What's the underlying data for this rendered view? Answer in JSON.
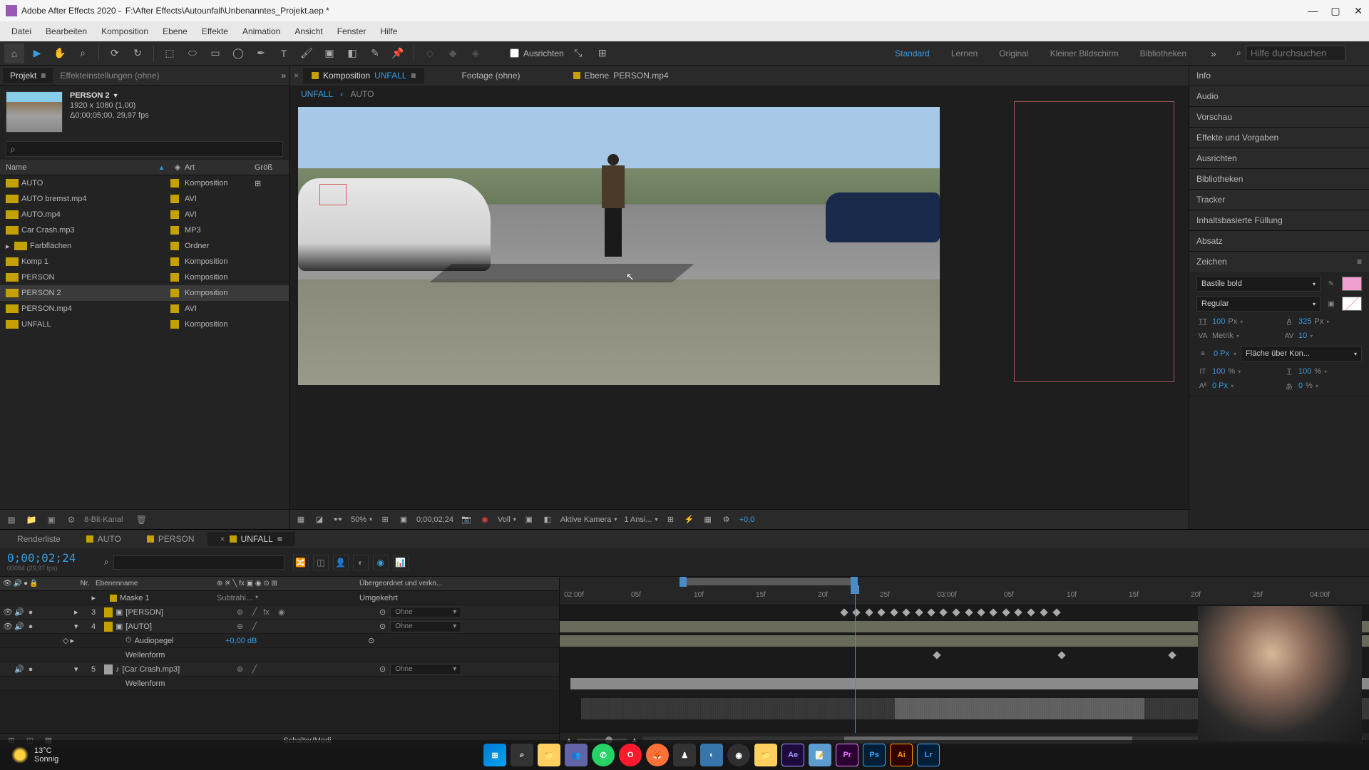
{
  "title": {
    "app_prefix": "Adobe After Effects 2020 -",
    "file_path": "F:\\After Effects\\Autounfall\\Unbenanntes_Projekt.aep *"
  },
  "menu": [
    "Datei",
    "Bearbeiten",
    "Komposition",
    "Ebene",
    "Effekte",
    "Animation",
    "Ansicht",
    "Fenster",
    "Hilfe"
  ],
  "toolbar": {
    "align_label": "Ausrichten"
  },
  "workspaces": [
    "Standard",
    "Lernen",
    "Original",
    "Kleiner Bildschirm",
    "Bibliotheken"
  ],
  "help_search_placeholder": "Hilfe durchsuchen",
  "left_tabs": {
    "project": "Projekt",
    "effects": "Effekteinstellungen (ohne)"
  },
  "project_thumb": {
    "name": "PERSON 2",
    "dims": "1920 x 1080 (1,00)",
    "duration": "Δ0;00;05;00, 29,97 fps"
  },
  "project_cols": {
    "name": "Name",
    "art": "Art",
    "size": "Größ"
  },
  "project_items": [
    {
      "name": "AUTO",
      "type": "Komposition",
      "color": "#c4a000",
      "icon": "comp"
    },
    {
      "name": "AUTO bremst.mp4",
      "type": "AVI",
      "color": "#c4a000",
      "icon": "avi"
    },
    {
      "name": "AUTO.mp4",
      "type": "AVI",
      "color": "#c4a000",
      "icon": "avi"
    },
    {
      "name": "Car Crash.mp3",
      "type": "MP3",
      "color": "#c4a000",
      "icon": "mp3"
    },
    {
      "name": "Farbflächen",
      "type": "Ordner",
      "color": "#c4a000",
      "icon": "folder"
    },
    {
      "name": "Komp 1",
      "type": "Komposition",
      "color": "#c4a000",
      "icon": "comp"
    },
    {
      "name": "PERSON",
      "type": "Komposition",
      "color": "#c4a000",
      "icon": "comp"
    },
    {
      "name": "PERSON 2",
      "type": "Komposition",
      "color": "#c4a000",
      "icon": "comp",
      "selected": true
    },
    {
      "name": "PERSON.mp4",
      "type": "AVI",
      "color": "#c4a000",
      "icon": "mp4"
    },
    {
      "name": "UNFALL",
      "type": "Komposition",
      "color": "#c4a000",
      "icon": "comp"
    }
  ],
  "depth_label": "8-Bit-Kanal",
  "viewer_tabs": {
    "comp_prefix": "Komposition",
    "comp_name": "UNFALL",
    "footage": "Footage (ohne)",
    "layer_prefix": "Ebene",
    "layer_name": "PERSON.mp4"
  },
  "breadcrumb": [
    "UNFALL",
    "AUTO"
  ],
  "viewer_footer": {
    "zoom": "50%",
    "time": "0;00;02;24",
    "res": "Voll",
    "camera": "Aktive Kamera",
    "view_count": "1 Ansi...",
    "exposure": "+0,0"
  },
  "right_panels": [
    "Info",
    "Audio",
    "Vorschau",
    "Effekte und Vorgaben",
    "Ausrichten",
    "Bibliotheken",
    "Tracker",
    "Inhaltsbasierte Füllung",
    "Absatz",
    "Zeichen"
  ],
  "char": {
    "font": "Bastile bold",
    "style": "Regular",
    "size": "100",
    "size_unit": "Px",
    "leading": "325",
    "leading_unit": "Px",
    "kerning": "Metrik",
    "tracking": "10",
    "stroke_w": "0 Px",
    "stroke_mode": "Fläche über Kon...",
    "vscale": "100",
    "hscale": "100",
    "baseline": "0 Px",
    "tsume": "0"
  },
  "timeline_tabs": [
    "Renderliste",
    "AUTO",
    "PERSON",
    "UNFALL"
  ],
  "timecode": "0;00;02;24",
  "timecode_sub": "00084 (29,97 fps)",
  "layer_cols": {
    "num": "Nr.",
    "name": "Ebenenname",
    "parent": "Übergeordnet und verkn..."
  },
  "layers": [
    {
      "num": "",
      "name": "Maske 1",
      "sub": true,
      "mode": "Subtrahi...",
      "inverted": "Umgekehrt"
    },
    {
      "num": "3",
      "name": "[PERSON]",
      "color": "#c4a000",
      "parent": "Ohne"
    },
    {
      "num": "4",
      "name": "[AUTO]",
      "color": "#c4a000",
      "parent": "Ohne"
    },
    {
      "num": "",
      "name": "Audiopegel",
      "sub": true,
      "value": "+0,00 dB"
    },
    {
      "num": "",
      "name": "Wellenform",
      "sub": true
    },
    {
      "num": "5",
      "name": "[Car Crash.mp3]",
      "color": "#b0b0b0",
      "parent": "Ohne"
    },
    {
      "num": "",
      "name": "Wellenform",
      "sub": true
    }
  ],
  "ruler_ticks": [
    "02:00f",
    "05f",
    "10f",
    "15f",
    "20f",
    "25f",
    "03:00f",
    "05f",
    "10f",
    "15f",
    "20f",
    "25f",
    "04:00f"
  ],
  "switch_label": "Schalter/Modi",
  "weather": {
    "temp": "13°C",
    "desc": "Sonnig"
  }
}
